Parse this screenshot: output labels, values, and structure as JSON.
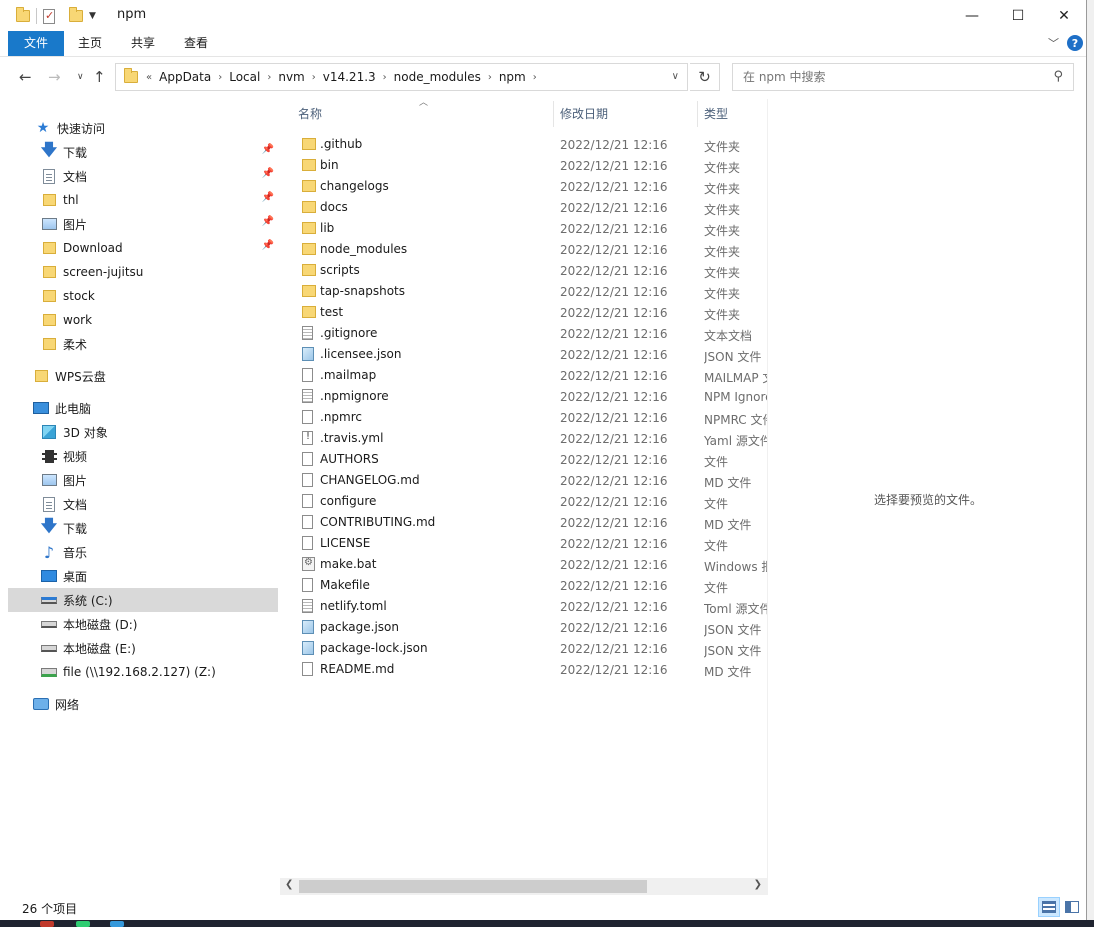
{
  "window": {
    "title": "npm",
    "controls": {
      "minimize": "—",
      "maximize": "☐",
      "close": "✕"
    }
  },
  "ribbon": {
    "tabs": [
      "文件",
      "主页",
      "共享",
      "查看"
    ],
    "help": "?"
  },
  "address": {
    "overflow": "«",
    "crumbs": [
      "AppData",
      "Local",
      "nvm",
      "v14.21.3",
      "node_modules",
      "npm"
    ],
    "search_placeholder": "在 npm 中搜索"
  },
  "sidebar": {
    "items": [
      {
        "label": "快速访问",
        "icon": "star-icon",
        "pinned": false
      },
      {
        "label": "下载",
        "icon": "download-icon",
        "pinned": true
      },
      {
        "label": "文档",
        "icon": "document-icon",
        "pinned": true
      },
      {
        "label": "thl",
        "icon": "folder-icon",
        "pinned": true
      },
      {
        "label": "图片",
        "icon": "pictures-icon",
        "pinned": true
      },
      {
        "label": "Download",
        "icon": "folder-icon",
        "pinned": true
      },
      {
        "label": "screen-jujitsu",
        "icon": "folder-icon",
        "pinned": false
      },
      {
        "label": "stock",
        "icon": "folder-icon",
        "pinned": false
      },
      {
        "label": "work",
        "icon": "folder-icon",
        "pinned": false
      },
      {
        "label": "柔术",
        "icon": "folder-icon",
        "pinned": false
      },
      {
        "label": "WPS云盘",
        "icon": "folder-icon",
        "pinned": false
      },
      {
        "label": "此电脑",
        "icon": "computer-icon",
        "pinned": false
      },
      {
        "label": "3D 对象",
        "icon": "3d-objects-icon",
        "pinned": false
      },
      {
        "label": "视频",
        "icon": "video-icon",
        "pinned": false
      },
      {
        "label": "图片",
        "icon": "pictures-icon",
        "pinned": false
      },
      {
        "label": "文档",
        "icon": "document-icon",
        "pinned": false
      },
      {
        "label": "下载",
        "icon": "download-icon",
        "pinned": false
      },
      {
        "label": "音乐",
        "icon": "music-icon",
        "pinned": false
      },
      {
        "label": "桌面",
        "icon": "desktop-icon",
        "pinned": false
      },
      {
        "label": "系统 (C:)",
        "icon": "system-drive-icon",
        "pinned": false,
        "selected": true
      },
      {
        "label": "本地磁盘 (D:)",
        "icon": "drive-icon",
        "pinned": false
      },
      {
        "label": "本地磁盘 (E:)",
        "icon": "drive-icon",
        "pinned": false
      },
      {
        "label": "file (\\\\192.168.2.127) (Z:)",
        "icon": "network-drive-icon",
        "pinned": false
      },
      {
        "label": "网络",
        "icon": "network-icon",
        "pinned": false
      }
    ]
  },
  "columns": {
    "name": "名称",
    "date": "修改日期",
    "type": "类型"
  },
  "files": [
    {
      "name": ".github",
      "date": "2022/12/21 12:16",
      "type": "文件夹",
      "icon": "folder"
    },
    {
      "name": "bin",
      "date": "2022/12/21 12:16",
      "type": "文件夹",
      "icon": "folder"
    },
    {
      "name": "changelogs",
      "date": "2022/12/21 12:16",
      "type": "文件夹",
      "icon": "folder"
    },
    {
      "name": "docs",
      "date": "2022/12/21 12:16",
      "type": "文件夹",
      "icon": "folder"
    },
    {
      "name": "lib",
      "date": "2022/12/21 12:16",
      "type": "文件夹",
      "icon": "folder"
    },
    {
      "name": "node_modules",
      "date": "2022/12/21 12:16",
      "type": "文件夹",
      "icon": "folder"
    },
    {
      "name": "scripts",
      "date": "2022/12/21 12:16",
      "type": "文件夹",
      "icon": "folder"
    },
    {
      "name": "tap-snapshots",
      "date": "2022/12/21 12:16",
      "type": "文件夹",
      "icon": "folder"
    },
    {
      "name": "test",
      "date": "2022/12/21 12:16",
      "type": "文件夹",
      "icon": "folder"
    },
    {
      "name": ".gitignore",
      "date": "2022/12/21 12:16",
      "type": "文本文档",
      "icon": "text"
    },
    {
      "name": ".licensee.json",
      "date": "2022/12/21 12:16",
      "type": "JSON 文件",
      "icon": "json"
    },
    {
      "name": ".mailmap",
      "date": "2022/12/21 12:16",
      "type": "MAILMAP 文件",
      "icon": "file"
    },
    {
      "name": ".npmignore",
      "date": "2022/12/21 12:16",
      "type": "NPM Ignore",
      "icon": "text"
    },
    {
      "name": ".npmrc",
      "date": "2022/12/21 12:16",
      "type": "NPMRC 文件",
      "icon": "file"
    },
    {
      "name": ".travis.yml",
      "date": "2022/12/21 12:16",
      "type": "Yaml 源文件",
      "icon": "yaml"
    },
    {
      "name": "AUTHORS",
      "date": "2022/12/21 12:16",
      "type": "文件",
      "icon": "file"
    },
    {
      "name": "CHANGELOG.md",
      "date": "2022/12/21 12:16",
      "type": "MD 文件",
      "icon": "file"
    },
    {
      "name": "configure",
      "date": "2022/12/21 12:16",
      "type": "文件",
      "icon": "file"
    },
    {
      "name": "CONTRIBUTING.md",
      "date": "2022/12/21 12:16",
      "type": "MD 文件",
      "icon": "file"
    },
    {
      "name": "LICENSE",
      "date": "2022/12/21 12:16",
      "type": "文件",
      "icon": "file"
    },
    {
      "name": "make.bat",
      "date": "2022/12/21 12:16",
      "type": "Windows 批处理文件",
      "icon": "bat"
    },
    {
      "name": "Makefile",
      "date": "2022/12/21 12:16",
      "type": "文件",
      "icon": "file"
    },
    {
      "name": "netlify.toml",
      "date": "2022/12/21 12:16",
      "type": "Toml 源文件",
      "icon": "text"
    },
    {
      "name": "package.json",
      "date": "2022/12/21 12:16",
      "type": "JSON 文件",
      "icon": "json"
    },
    {
      "name": "package-lock.json",
      "date": "2022/12/21 12:16",
      "type": "JSON 文件",
      "icon": "json"
    },
    {
      "name": "README.md",
      "date": "2022/12/21 12:16",
      "type": "MD 文件",
      "icon": "file"
    }
  ],
  "preview": {
    "message": "选择要预览的文件。"
  },
  "status": {
    "count": "26 个项目"
  },
  "colors": {
    "accent": "#1979ca",
    "selected": "#d9d9d9",
    "folder": "#f8d775"
  }
}
